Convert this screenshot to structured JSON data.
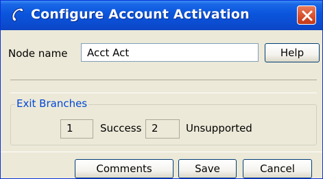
{
  "window": {
    "title": "Configure Account Activation",
    "app_icon": "phone-handset-icon",
    "close_icon": "close-icon"
  },
  "form": {
    "node_name_label": "Node name",
    "node_name_value": "Acct Act",
    "help_label": "Help"
  },
  "exit_branches": {
    "legend": "Exit Branches",
    "branches": [
      {
        "number": "1",
        "label": "Success"
      },
      {
        "number": "2",
        "label": "Unsupported"
      }
    ]
  },
  "buttons": {
    "comments": "Comments",
    "save": "Save",
    "cancel": "Cancel"
  },
  "colors": {
    "titlebar": "#0b4cd0",
    "window_bg": "#ece9d8",
    "legend_text": "#0046d5",
    "close_button": "#d9502c"
  }
}
